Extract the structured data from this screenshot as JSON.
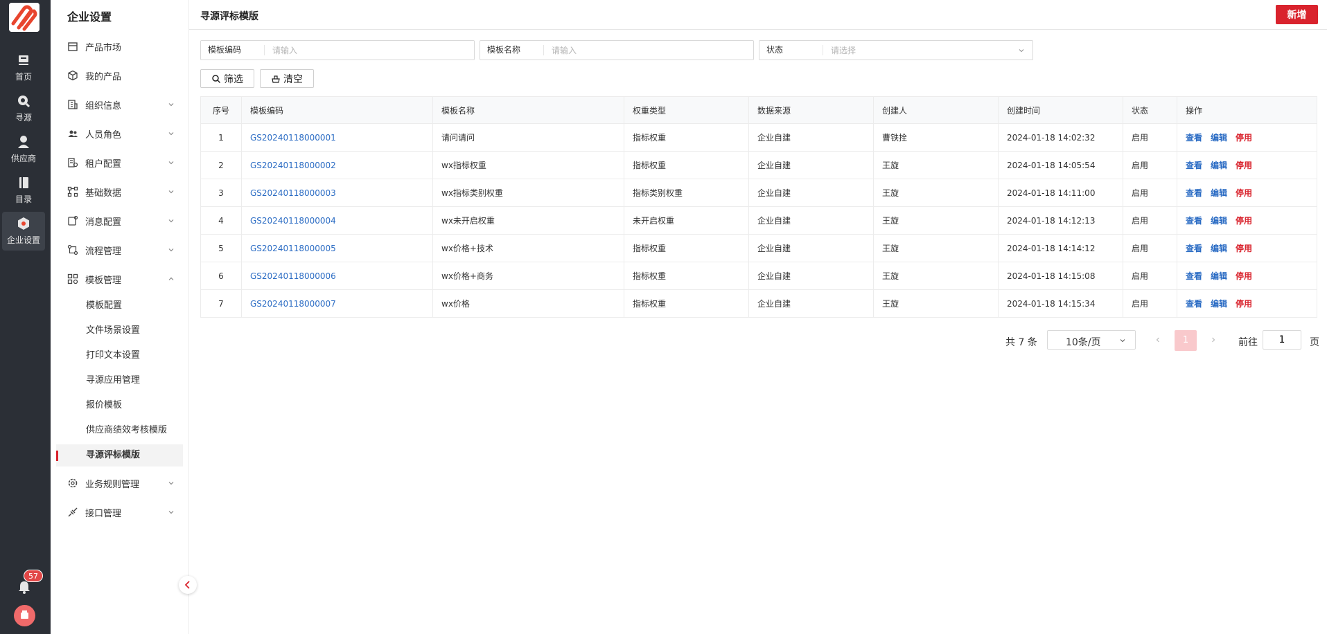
{
  "rail": {
    "items": [
      {
        "label": "首页",
        "icon": "home-icon"
      },
      {
        "label": "寻源",
        "icon": "sourcing-icon"
      },
      {
        "label": "供应商",
        "icon": "supplier-icon"
      },
      {
        "label": "目录",
        "icon": "catalog-icon"
      },
      {
        "label": "企业设置",
        "icon": "enterprise-settings-icon",
        "active": true
      }
    ],
    "notification_count": "57"
  },
  "sidebar": {
    "title": "企业设置",
    "items": [
      {
        "label": "产品市场"
      },
      {
        "label": "我的产品"
      },
      {
        "label": "组织信息"
      },
      {
        "label": "人员角色"
      },
      {
        "label": "租户配置"
      },
      {
        "label": "基础数据"
      },
      {
        "label": "消息配置"
      },
      {
        "label": "流程管理"
      },
      {
        "label": "模板管理"
      },
      {
        "label": "业务规则管理"
      },
      {
        "label": "接口管理"
      }
    ],
    "template_sub": [
      {
        "label": "模板配置"
      },
      {
        "label": "文件场景设置"
      },
      {
        "label": "打印文本设置"
      },
      {
        "label": "寻源应用管理"
      },
      {
        "label": "报价模板"
      },
      {
        "label": "供应商绩效考核模版"
      },
      {
        "label": "寻源评标模版"
      }
    ]
  },
  "header": {
    "title": "寻源评标模版",
    "add_label": "新增"
  },
  "filters": {
    "code": {
      "label": "模板编码",
      "placeholder": "请输入"
    },
    "name": {
      "label": "模板名称",
      "placeholder": "请输入"
    },
    "status": {
      "label": "状态",
      "placeholder": "请选择"
    },
    "search_label": "筛选",
    "clear_label": "清空"
  },
  "table": {
    "columns": [
      "序号",
      "模板编码",
      "模板名称",
      "权重类型",
      "数据来源",
      "创建人",
      "创建时间",
      "状态",
      "操作"
    ],
    "actions": {
      "view": "查看",
      "edit": "编辑",
      "disable": "停用"
    },
    "rows": [
      {
        "no": "1",
        "code": "GS20240118000001",
        "name": "请问请问",
        "weight": "指标权重",
        "source": "企业自建",
        "creator": "曹铁拴",
        "time": "2024-01-18 14:02:32",
        "status": "启用"
      },
      {
        "no": "2",
        "code": "GS20240118000002",
        "name": "wx指标权重",
        "weight": "指标权重",
        "source": "企业自建",
        "creator": "王旋",
        "time": "2024-01-18 14:05:54",
        "status": "启用"
      },
      {
        "no": "3",
        "code": "GS20240118000003",
        "name": "wx指标类别权重",
        "weight": "指标类别权重",
        "source": "企业自建",
        "creator": "王旋",
        "time": "2024-01-18 14:11:00",
        "status": "启用"
      },
      {
        "no": "4",
        "code": "GS20240118000004",
        "name": "wx未开启权重",
        "weight": "未开启权重",
        "source": "企业自建",
        "creator": "王旋",
        "time": "2024-01-18 14:12:13",
        "status": "启用"
      },
      {
        "no": "5",
        "code": "GS20240118000005",
        "name": "wx价格+技术",
        "weight": "指标权重",
        "source": "企业自建",
        "creator": "王旋",
        "time": "2024-01-18 14:14:12",
        "status": "启用"
      },
      {
        "no": "6",
        "code": "GS20240118000006",
        "name": "wx价格+商务",
        "weight": "指标权重",
        "source": "企业自建",
        "creator": "王旋",
        "time": "2024-01-18 14:15:08",
        "status": "启用"
      },
      {
        "no": "7",
        "code": "GS20240118000007",
        "name": "wx价格",
        "weight": "指标权重",
        "source": "企业自建",
        "creator": "王旋",
        "time": "2024-01-18 14:15:34",
        "status": "启用"
      }
    ]
  },
  "pagination": {
    "total": "共 7 条",
    "page_size": "10条/页",
    "current": "1",
    "goto_label": "前往",
    "goto_value": "1",
    "page_suffix": "页"
  },
  "colors": {
    "accent": "#d9232d",
    "link": "#2b6cc4",
    "rail_bg": "#2b2f36"
  }
}
